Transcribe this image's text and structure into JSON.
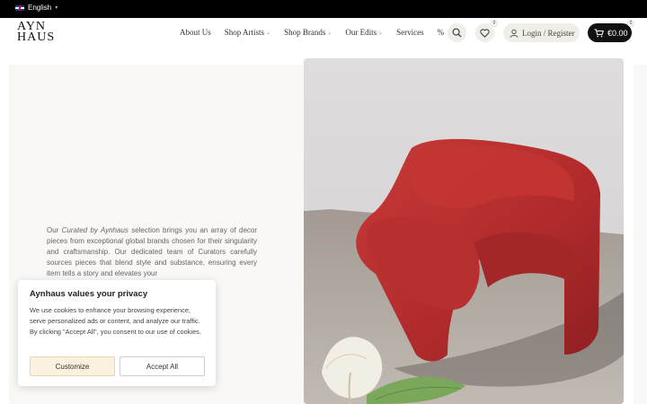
{
  "topbar": {
    "language": "English"
  },
  "logo": {
    "line1": "AYN",
    "line2": "HAUS"
  },
  "nav": {
    "items": [
      {
        "label": "About Us",
        "dropdown": false
      },
      {
        "label": "Shop Artists",
        "dropdown": true
      },
      {
        "label": "Shop Brands",
        "dropdown": true
      },
      {
        "label": "Our Edits",
        "dropdown": true
      },
      {
        "label": "Services",
        "dropdown": false
      },
      {
        "label": "%",
        "dropdown": false
      }
    ]
  },
  "header_actions": {
    "wishlist_count": "0",
    "login_label": "Login / Register",
    "cart_total": "€0.00",
    "cart_count": "0"
  },
  "intro": {
    "prefix": "Our ",
    "emphasis": "Curated by Aynhaus",
    "suffix": " selection brings you an array of decor pieces from exceptional global brands chosen for their singularity and craftsmanship. Our dedicated team of Curators carefully sources pieces that blend style and substance, ensuring every item tells a story and elevates your"
  },
  "cookie": {
    "title": "Aynhaus values your privacy",
    "body": "We use cookies to enhance your browsing experience, serve personalized ads or content, and analyze our traffic. By clicking \"Accept All\", you consent to our use of cookies.",
    "customize_label": "Customize",
    "accept_label": "Accept All"
  },
  "colors": {
    "topbar": "#000000",
    "panel": "#faf8f5",
    "chair_red": "#b8302f",
    "customize_bg": "#fbf1de"
  }
}
